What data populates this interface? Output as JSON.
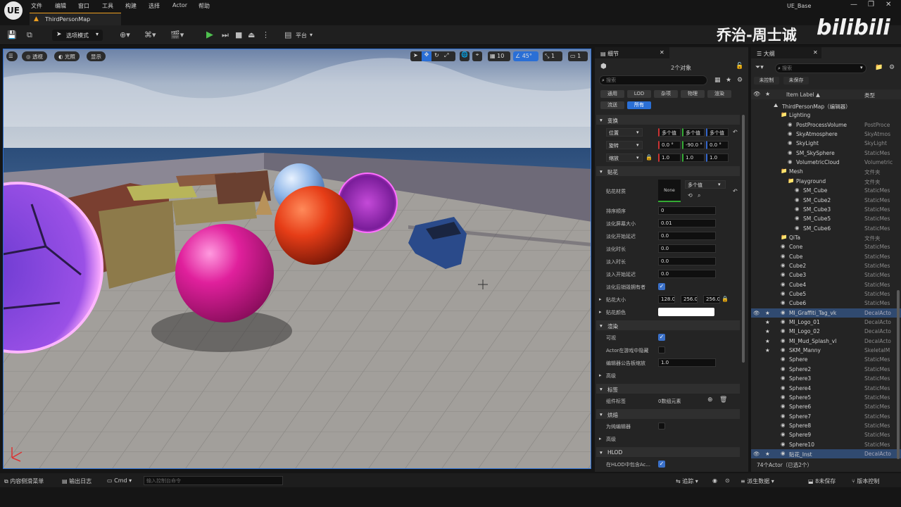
{
  "app": {
    "title": "UE_Base",
    "logo": "UE",
    "map_tab": "ThirdPersonMap"
  },
  "menu": [
    "文件",
    "编辑",
    "窗口",
    "工具",
    "构建",
    "选择",
    "Actor",
    "帮助"
  ],
  "watermark": {
    "author": "乔治-周士诚",
    "brand": "bilibili"
  },
  "toolbar": {
    "mode": "选项模式",
    "platform": "平台"
  },
  "viewport": {
    "perspective": "透视",
    "lit": "光照",
    "show": "显示",
    "grid": "10",
    "angle": "45°",
    "scale": "1",
    "camera": "1"
  },
  "details": {
    "tab": "细节",
    "count": "2个对象",
    "search_placeholder": "搜索",
    "filters": [
      "通用",
      "LOD",
      "杂项",
      "物理",
      "渲染",
      "流送",
      "所有"
    ],
    "sections": {
      "transform": "变换",
      "decal": "贴花",
      "rendering": "渲染",
      "advanced1": "高级",
      "tags": "标签",
      "cooking": "烘焙",
      "advanced2": "高级",
      "hlod": "HLOD"
    },
    "transform": {
      "location_label": "位置",
      "rotation_label": "旋转",
      "scale_label": "缩放",
      "location": [
        "多个值",
        "多个值",
        "多个值"
      ],
      "rotation": [
        "0.0 °",
        "-90.0 °",
        "0.0 °"
      ],
      "scale": [
        "1.0",
        "1.0",
        "1.0"
      ]
    },
    "decal": {
      "material_label": "贴花材质",
      "material_thumb": "None",
      "material_value": "多个值",
      "sort_label": "排序顺序",
      "sort": "0",
      "fade_screen_label": "淡化屏幕大小",
      "fade_screen": "0.01",
      "fade_start_label": "淡化开始延迟",
      "fade_start": "0.0",
      "fade_dur_label": "淡化时长",
      "fade_dur": "0.0",
      "fadein_dur_label": "淡入时长",
      "fadein_dur": "0.0",
      "fadein_start_label": "淡入开始延迟",
      "fadein_start": "0.0",
      "destroy_label": "淡化后销毁拥有者",
      "size_label": "贴花大小",
      "size": [
        "128.0",
        "256.0",
        "256.0"
      ],
      "color_label": "贴花颜色"
    },
    "rendering": {
      "visible_label": "可视",
      "hidden_label": "Actor在游戏中隐藏",
      "billboard_label": "编辑器公告板缩放",
      "billboard": "1.0"
    },
    "tags": {
      "component_label": "组件标签",
      "component_value": "0数组元素"
    },
    "cooking": {
      "editor_only_label": "为纯编辑器"
    },
    "hlod": {
      "include_label": "在HLOD中包含Ac..."
    }
  },
  "outliner": {
    "tab": "大纲",
    "search_placeholder": "搜索",
    "unsaved1": "未控制",
    "unsaved2": "未保存",
    "col_label": "Item Label ▲",
    "col_type": "类型",
    "footer": "74个Actor（已选2个）",
    "rows": [
      {
        "name": "ThirdPersonMap（编辑器）",
        "type": "",
        "indent": 1,
        "kind": "map"
      },
      {
        "name": "Lighting",
        "type": "",
        "indent": 2,
        "kind": "folder"
      },
      {
        "name": "PostProcessVolume",
        "type": "PostProce",
        "indent": 3,
        "kind": "actor"
      },
      {
        "name": "SkyAtmosphere",
        "type": "SkyAtmos",
        "indent": 3,
        "kind": "actor"
      },
      {
        "name": "SkyLight",
        "type": "SkyLight",
        "indent": 3,
        "kind": "actor"
      },
      {
        "name": "SM_SkySphere",
        "type": "StaticMes",
        "indent": 3,
        "kind": "actor"
      },
      {
        "name": "VolumetricCloud",
        "type": "Volumetric",
        "indent": 3,
        "kind": "actor"
      },
      {
        "name": "Mesh",
        "type": "文件夹",
        "indent": 2,
        "kind": "folder"
      },
      {
        "name": "Playground",
        "type": "文件夹",
        "indent": 3,
        "kind": "folder"
      },
      {
        "name": "SM_Cube",
        "type": "StaticMes",
        "indent": 4,
        "kind": "actor"
      },
      {
        "name": "SM_Cube2",
        "type": "StaticMes",
        "indent": 4,
        "kind": "actor"
      },
      {
        "name": "SM_Cube3",
        "type": "StaticMes",
        "indent": 4,
        "kind": "actor"
      },
      {
        "name": "SM_Cube5",
        "type": "StaticMes",
        "indent": 4,
        "kind": "actor"
      },
      {
        "name": "SM_Cube6",
        "type": "StaticMes",
        "indent": 4,
        "kind": "actor"
      },
      {
        "name": "QiTa",
        "type": "文件夹",
        "indent": 2,
        "kind": "folder"
      },
      {
        "name": "Cone",
        "type": "StaticMes",
        "indent": 2,
        "kind": "actor"
      },
      {
        "name": "Cube",
        "type": "StaticMes",
        "indent": 2,
        "kind": "actor"
      },
      {
        "name": "Cube2",
        "type": "StaticMes",
        "indent": 2,
        "kind": "actor"
      },
      {
        "name": "Cube3",
        "type": "StaticMes",
        "indent": 2,
        "kind": "actor"
      },
      {
        "name": "Cube4",
        "type": "StaticMes",
        "indent": 2,
        "kind": "actor"
      },
      {
        "name": "Cube5",
        "type": "StaticMes",
        "indent": 2,
        "kind": "actor"
      },
      {
        "name": "Cube6",
        "type": "StaticMes",
        "indent": 2,
        "kind": "actor"
      },
      {
        "name": "MI_Graffiti_Tag_vk",
        "type": "DecalActo",
        "indent": 2,
        "kind": "actor",
        "selected": true
      },
      {
        "name": "MI_Logo_01",
        "type": "DecalActo",
        "indent": 2,
        "kind": "actor"
      },
      {
        "name": "MI_Logo_02",
        "type": "DecalActo",
        "indent": 2,
        "kind": "actor"
      },
      {
        "name": "MI_Mud_Splash_vl",
        "type": "DecalActo",
        "indent": 2,
        "kind": "actor"
      },
      {
        "name": "SKM_Manny",
        "type": "SkeletalM",
        "indent": 2,
        "kind": "actor"
      },
      {
        "name": "Sphere",
        "type": "StaticMes",
        "indent": 2,
        "kind": "actor"
      },
      {
        "name": "Sphere2",
        "type": "StaticMes",
        "indent": 2,
        "kind": "actor"
      },
      {
        "name": "Sphere3",
        "type": "StaticMes",
        "indent": 2,
        "kind": "actor"
      },
      {
        "name": "Sphere4",
        "type": "StaticMes",
        "indent": 2,
        "kind": "actor"
      },
      {
        "name": "Sphere5",
        "type": "StaticMes",
        "indent": 2,
        "kind": "actor"
      },
      {
        "name": "Sphere6",
        "type": "StaticMes",
        "indent": 2,
        "kind": "actor"
      },
      {
        "name": "Sphere7",
        "type": "StaticMes",
        "indent": 2,
        "kind": "actor"
      },
      {
        "name": "Sphere8",
        "type": "StaticMes",
        "indent": 2,
        "kind": "actor"
      },
      {
        "name": "Sphere9",
        "type": "StaticMes",
        "indent": 2,
        "kind": "actor"
      },
      {
        "name": "Sphere10",
        "type": "StaticMes",
        "indent": 2,
        "kind": "actor"
      },
      {
        "name": "贴花_Inst",
        "type": "DecalActo",
        "indent": 2,
        "kind": "actor",
        "selected": true
      }
    ]
  },
  "statusbar": {
    "content_drawer": "内容侧滑菜单",
    "output_log": "输出日志",
    "cmd": "Cmd",
    "cmd_placeholder": "输入控制台命令",
    "trace": "追踪",
    "derived_data": "派生数据",
    "unsaved": "8未保存",
    "source_control": "版本控制"
  },
  "colors": {
    "accent_blue": "#2a6fd6",
    "selection": "#304a70",
    "panel": "#242424"
  }
}
